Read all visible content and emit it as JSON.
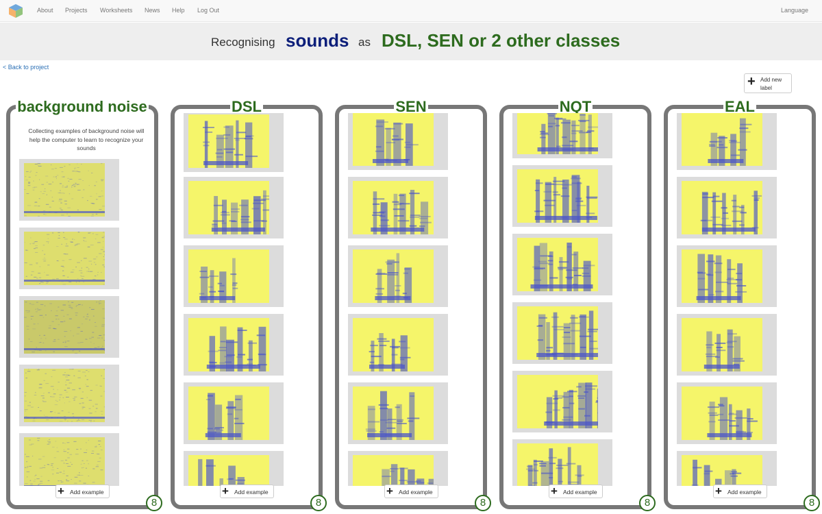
{
  "nav": {
    "links": [
      "About",
      "Projects",
      "Worksheets",
      "News",
      "Help",
      "Log Out"
    ],
    "language": "Language"
  },
  "banner": {
    "prefix": "Recognising",
    "type": "sounds",
    "as": "as",
    "classes": "DSL, SEN or 2 other classes"
  },
  "back_link": "< Back to project",
  "add_label": {
    "plus": "+",
    "text": "Add new label"
  },
  "columns": [
    {
      "title": "background noise",
      "help": "Collecting examples of background noise will help the computer to learn to recognize your sounds",
      "add": "Add example",
      "count": "8"
    },
    {
      "title": "DSL",
      "add": "Add example",
      "count": "8"
    },
    {
      "title": "SEN",
      "add": "Add example",
      "count": "8"
    },
    {
      "title": "NQT",
      "add": "Add example",
      "count": "8"
    },
    {
      "title": "EAL",
      "add": "Add example",
      "count": "8"
    }
  ],
  "colors": {
    "accent": "#2d6b1e",
    "sounds": "#0d1f7a",
    "border": "#777777",
    "spectrogram_bg": "#f5f56a",
    "spectrogram_ink": "#4b56c8"
  },
  "icons": {
    "plus": "plus-icon",
    "logo": "cube-logo"
  }
}
